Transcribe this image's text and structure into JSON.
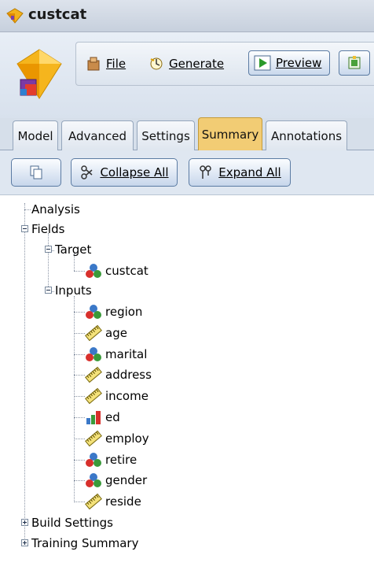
{
  "window": {
    "title": "custcat"
  },
  "toolbar": {
    "file_label": "File",
    "generate_label": "Generate",
    "preview_label": "Preview"
  },
  "tabs": [
    {
      "label": "Model"
    },
    {
      "label": "Advanced"
    },
    {
      "label": "Settings"
    },
    {
      "label": "Summary"
    },
    {
      "label": "Annotations"
    }
  ],
  "active_tab": "Summary",
  "summary_tools": {
    "collapse_all_label": "Collapse All",
    "expand_all_label": "Expand All"
  },
  "tree": {
    "analysis": "Analysis",
    "fields": "Fields",
    "target": "Target",
    "target_field": {
      "label": "custcat",
      "icon": "nominal-icon"
    },
    "inputs": "Inputs",
    "input_fields": [
      {
        "label": "region",
        "icon": "nominal-icon"
      },
      {
        "label": "age",
        "icon": "continuous-icon"
      },
      {
        "label": "marital",
        "icon": "nominal-icon"
      },
      {
        "label": "address",
        "icon": "continuous-icon"
      },
      {
        "label": "income",
        "icon": "continuous-icon"
      },
      {
        "label": "ed",
        "icon": "ordinal-icon"
      },
      {
        "label": "employ",
        "icon": "continuous-icon"
      },
      {
        "label": "retire",
        "icon": "nominal-icon"
      },
      {
        "label": "gender",
        "icon": "nominal-icon"
      },
      {
        "label": "reside",
        "icon": "continuous-icon"
      }
    ],
    "build_settings": "Build Settings",
    "training_summary": "Training Summary"
  }
}
